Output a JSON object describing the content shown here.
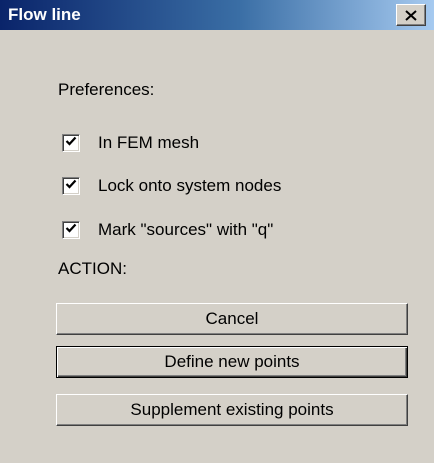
{
  "window": {
    "title": "Flow line",
    "close_icon": "close-icon"
  },
  "preferences": {
    "heading": "Preferences:",
    "options": [
      {
        "label": "In FEM mesh",
        "checked": true
      },
      {
        "label": "Lock onto system nodes",
        "checked": true
      },
      {
        "label": "Mark \"sources\" with \"q\"",
        "checked": true
      }
    ]
  },
  "action": {
    "heading": "ACTION:",
    "buttons": [
      {
        "label": "Cancel",
        "default": false
      },
      {
        "label": "Define new points",
        "default": true
      },
      {
        "label": "Supplement existing points",
        "default": false
      }
    ]
  },
  "colors": {
    "title_bar_start": "#0a246a",
    "title_bar_end": "#a6caf0",
    "dialog_face": "#d4d0c8"
  }
}
